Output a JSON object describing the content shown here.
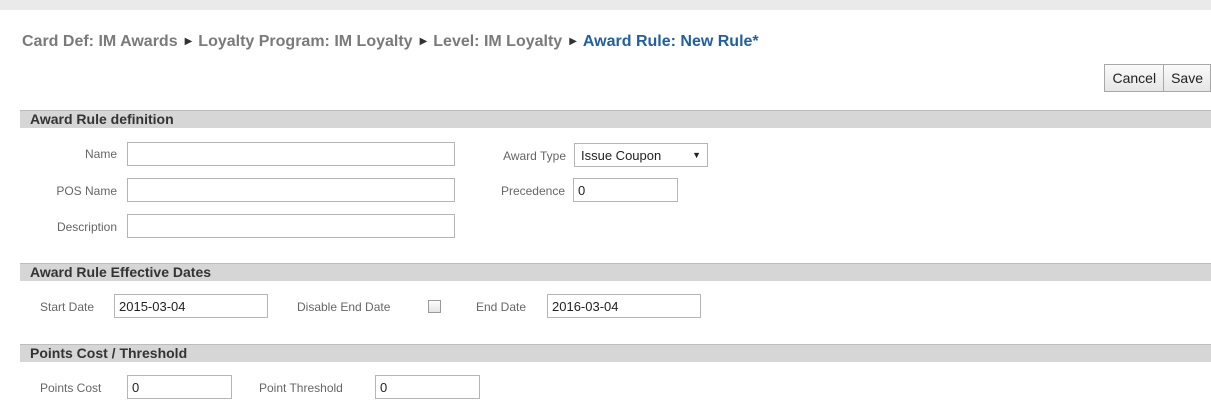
{
  "breadcrumb": {
    "items": [
      "Card Def: IM Awards",
      "Loyalty Program: IM Loyalty",
      "Level: IM Loyalty"
    ],
    "current": "Award Rule: New Rule*",
    "separator": "▶"
  },
  "toolbar": {
    "cancel_label": "Cancel",
    "save_label": "Save"
  },
  "definition": {
    "header": "Award Rule definition",
    "name_label": "Name",
    "name_value": "",
    "pos_name_label": "POS Name",
    "pos_name_value": "",
    "description_label": "Description",
    "description_value": "",
    "award_type_label": "Award Type",
    "award_type_value": "Issue Coupon",
    "precedence_label": "Precedence",
    "precedence_value": "0"
  },
  "dates": {
    "header": "Award Rule Effective Dates",
    "start_label": "Start Date",
    "start_value": "2015-03-04",
    "disable_end_label": "Disable End Date",
    "disable_end_checked": false,
    "end_label": "End Date",
    "end_value": "2016-03-04"
  },
  "points": {
    "header": "Points Cost / Threshold",
    "cost_label": "Points Cost",
    "cost_value": "0",
    "threshold_label": "Point Threshold",
    "threshold_value": "0"
  },
  "icons": {
    "dropdown": "caret-down-icon",
    "separator": "breadcrumb-arrow-icon"
  }
}
